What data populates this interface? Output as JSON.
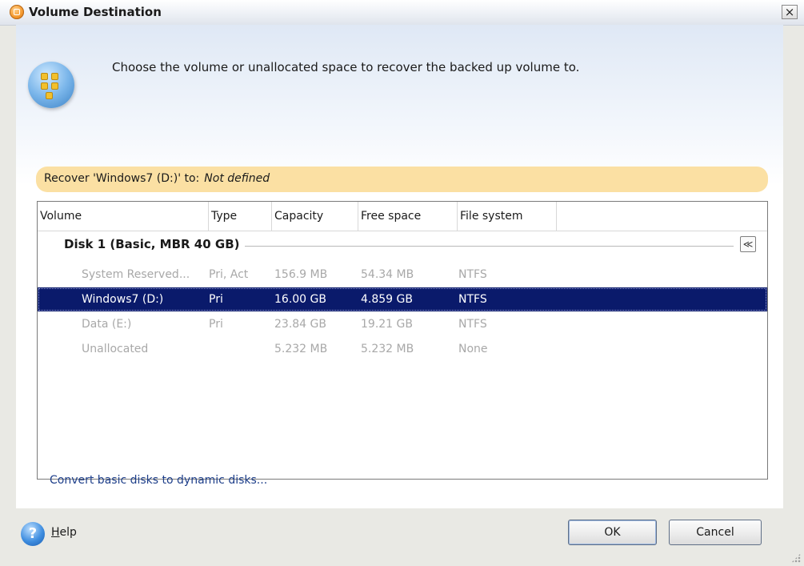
{
  "window": {
    "title": "Volume Destination",
    "close_glyph": "×"
  },
  "instruction": "Choose the volume or unallocated space to recover the backed up volume to.",
  "recover": {
    "label": "Recover 'Windows7 (D:)' to:",
    "value": "Not defined"
  },
  "table": {
    "columns": [
      "Volume",
      "Type",
      "Capacity",
      "Free space",
      "File system"
    ],
    "group": {
      "label": "Disk 1 (Basic, MBR 40 GB)",
      "collapse_glyph": "≪"
    },
    "rows": [
      {
        "volume": "System Reserved...",
        "type": "Pri, Act",
        "capacity": "156.9 MB",
        "free": "54.34 MB",
        "fs": "NTFS",
        "state": "disabled"
      },
      {
        "volume": "Windows7 (D:)",
        "type": "Pri",
        "capacity": "16.00 GB",
        "free": "4.859 GB",
        "fs": "NTFS",
        "state": "selected"
      },
      {
        "volume": "Data (E:)",
        "type": "Pri",
        "capacity": "23.84 GB",
        "free": "19.21 GB",
        "fs": "NTFS",
        "state": "disabled"
      },
      {
        "volume": "Unallocated",
        "type": "",
        "capacity": "5.232 MB",
        "free": "5.232 MB",
        "fs": "None",
        "state": "disabled"
      }
    ]
  },
  "links": {
    "convert": "Convert basic disks to dynamic disks..."
  },
  "footer": {
    "help_glyph": "?",
    "help_first": "H",
    "help_rest": "elp",
    "ok": "OK",
    "cancel": "Cancel"
  },
  "colors": {
    "selected_row": "#0a1a6b",
    "recover_bar": "#fbe0a3",
    "link": "#1e3f8a"
  },
  "icons": [
    "app-icon",
    "close-icon",
    "wizard-icon",
    "collapse-icon",
    "help-icon",
    "resize-grip-icon"
  ]
}
